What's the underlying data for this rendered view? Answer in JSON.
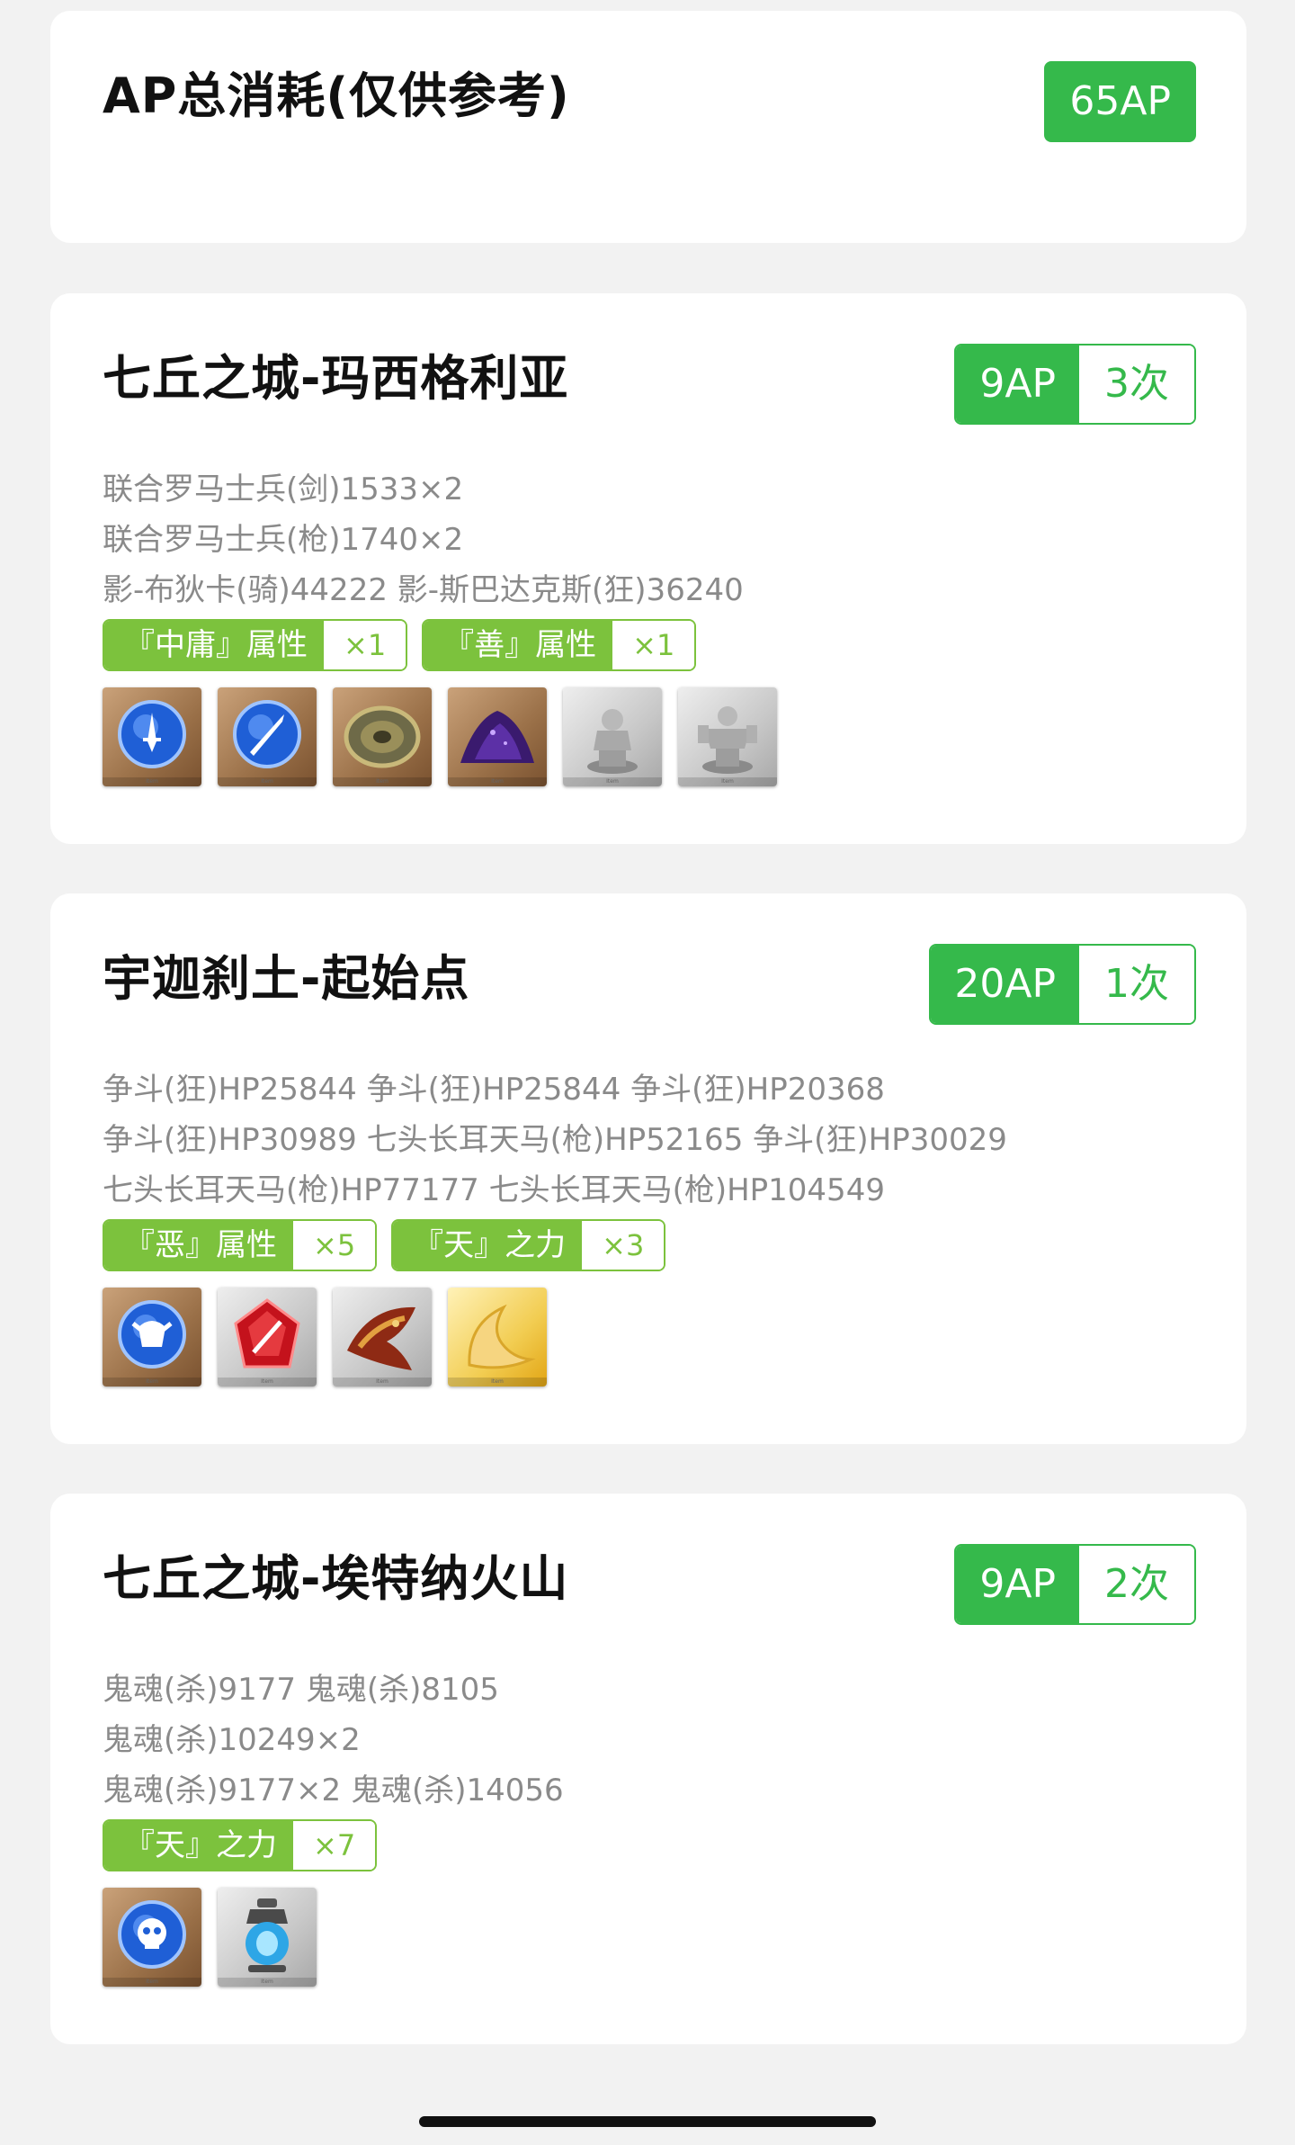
{
  "summary": {
    "title": "AP总消耗(仅供参考)",
    "total_ap": "65AP"
  },
  "quests": [
    {
      "title": "七丘之城-玛西格利亚",
      "ap": "9AP",
      "times": "3次",
      "enemies": [
        "联合罗马士兵(剑)1533×2",
        "联合罗马士兵(枪)1740×2",
        "影-布狄卡(骑)44222 影-斯巴达克斯(狂)36240"
      ],
      "traits": [
        {
          "name": "『中庸』属性",
          "count": "×1"
        },
        {
          "name": "『善』属性",
          "count": "×1"
        }
      ],
      "items": [
        {
          "icon": "blue-gem-sword-icon",
          "frame": "bronze"
        },
        {
          "icon": "blue-gem-lance-icon",
          "frame": "bronze"
        },
        {
          "icon": "bronze-disc-icon",
          "frame": "bronze"
        },
        {
          "icon": "purple-powder-icon",
          "frame": "bronze"
        },
        {
          "icon": "silver-statue-rider-icon",
          "frame": "silver"
        },
        {
          "icon": "silver-statue-berserker-icon",
          "frame": "silver"
        }
      ]
    },
    {
      "title": "宇迦刹土-起始点",
      "ap": "20AP",
      "times": "1次",
      "enemies": [
        "争斗(狂)HP25844 争斗(狂)HP25844 争斗(狂)HP20368",
        "争斗(狂)HP30989 七头长耳天马(枪)HP52165 争斗(狂)HP30029",
        "七头长耳天马(枪)HP77177 七头长耳天马(枪)HP104549"
      ],
      "traits": [
        {
          "name": "『恶』属性",
          "count": "×5"
        },
        {
          "name": "『天』之力",
          "count": "×3"
        }
      ],
      "items": [
        {
          "icon": "blue-gem-berserker-icon",
          "frame": "bronze"
        },
        {
          "icon": "red-gem-lance-icon",
          "frame": "silver"
        },
        {
          "icon": "dragon-fang-icon",
          "frame": "silver"
        },
        {
          "icon": "golden-horn-icon",
          "frame": "gold"
        }
      ]
    },
    {
      "title": "七丘之城-埃特纳火山",
      "ap": "9AP",
      "times": "2次",
      "enemies": [
        "鬼魂(杀)9177 鬼魂(杀)8105",
        "鬼魂(杀)10249×2",
        "鬼魂(杀)9177×2 鬼魂(杀)14056"
      ],
      "traits": [
        {
          "name": "『天』之力",
          "count": "×7"
        }
      ],
      "items": [
        {
          "icon": "blue-gem-assassin-icon",
          "frame": "bronze"
        },
        {
          "icon": "blue-lantern-icon",
          "frame": "silver"
        }
      ]
    }
  ],
  "item_caption": "Item",
  "colors": {
    "primary_green": "#35b94b",
    "tag_green": "#7cc23d",
    "background": "#f2f2f2",
    "text_gray": "#8a8a8a"
  }
}
